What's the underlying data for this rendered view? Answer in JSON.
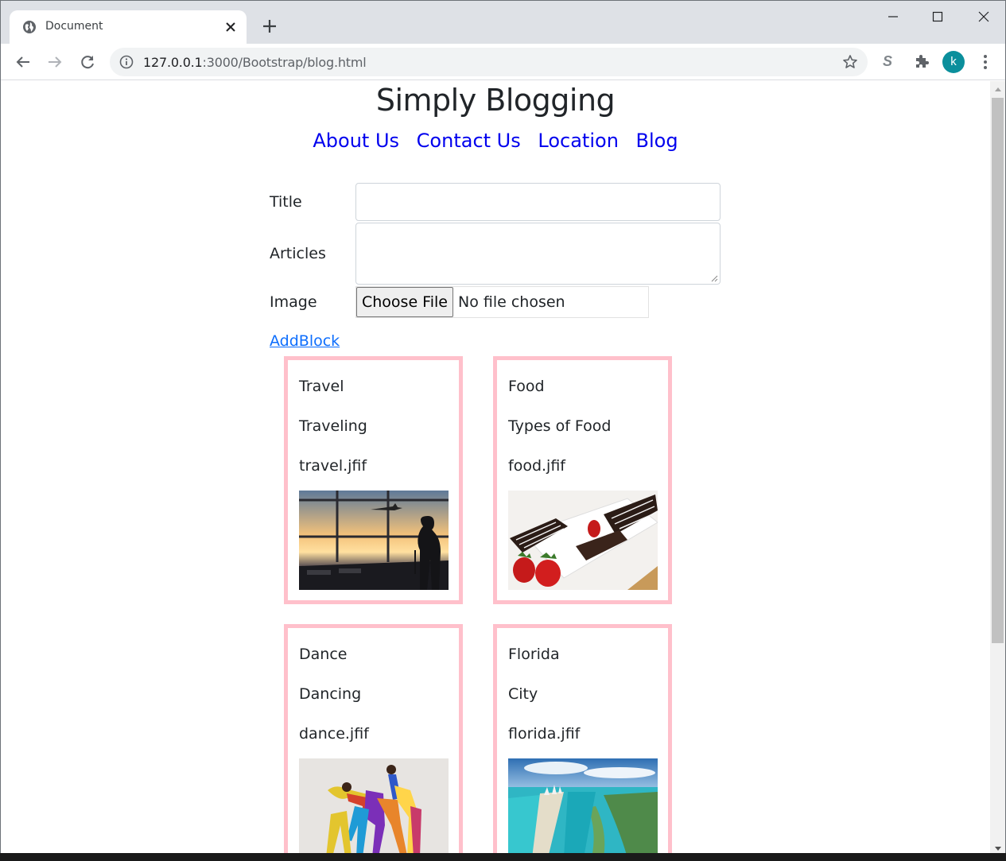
{
  "browser": {
    "tab_title": "Document",
    "url_host": "127.0.0.1",
    "url_path": ":3000/Bootstrap/blog.html",
    "extension_letter": "S",
    "avatar_letter": "k",
    "avatar_color": "#0b8f9c"
  },
  "page": {
    "title": "Simply Blogging",
    "nav": [
      "About Us",
      "Contact Us",
      "Location",
      "Blog"
    ],
    "nav_color": "#0000ee"
  },
  "form": {
    "title_label": "Title",
    "title_value": "",
    "articles_label": "Articles",
    "articles_value": "",
    "image_label": "Image",
    "file_button": "Choose File",
    "file_status": "No file chosen",
    "add_link": "AddBlock"
  },
  "cards": [
    {
      "title": "Travel",
      "text": "Traveling",
      "file": "travel.jfif",
      "image": "airport-sunset"
    },
    {
      "title": "Food",
      "text": "Types of Food",
      "file": "food.jfif",
      "image": "chocolate-strawberries"
    },
    {
      "title": "Dance",
      "text": "Dancing",
      "file": "dance.jfif",
      "image": "dance-group"
    },
    {
      "title": "Florida",
      "text": "City",
      "file": "florida.jfif",
      "image": "miami-aerial"
    }
  ],
  "card_border_color": "#ffc0cb"
}
